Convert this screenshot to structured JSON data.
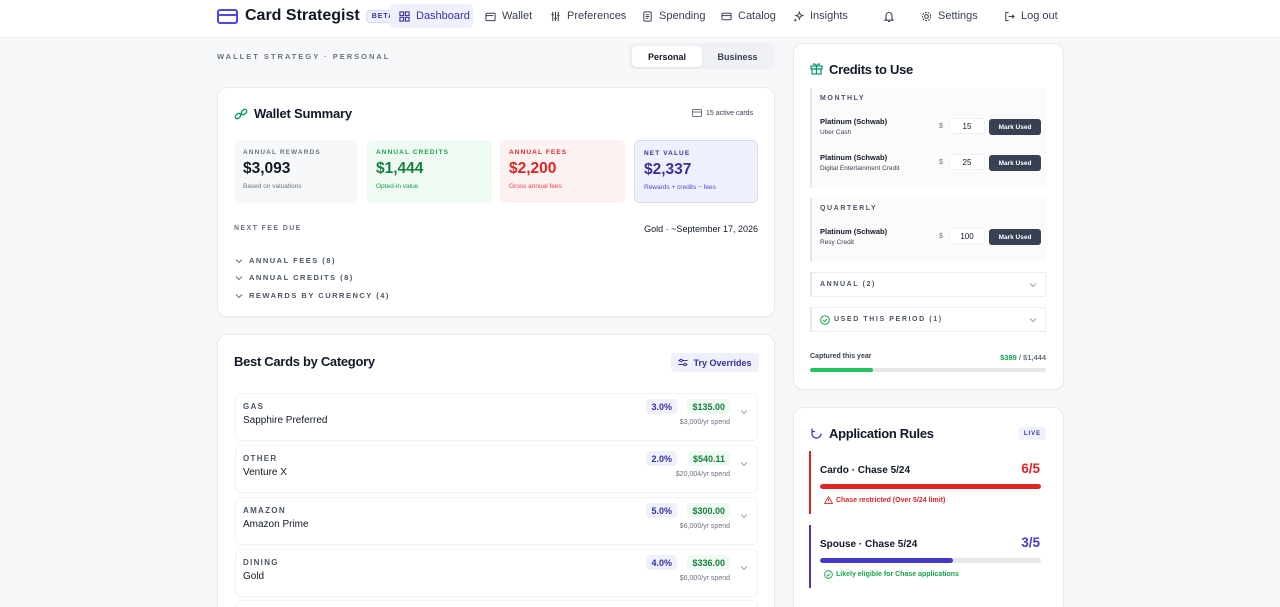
{
  "nav": {
    "brand": "Card Strategist",
    "badge": "BETA",
    "items": [
      {
        "label": "Dashboard",
        "active": true,
        "icon": "dashboard-icon"
      },
      {
        "label": "Wallet",
        "icon": "wallet-icon"
      },
      {
        "label": "Preferences",
        "icon": "sliders-icon"
      },
      {
        "label": "Spending",
        "icon": "receipt-icon"
      },
      {
        "label": "Catalog",
        "icon": "card-icon"
      },
      {
        "label": "Insights",
        "icon": "sparkles-icon"
      }
    ],
    "settings_label": "Settings",
    "logout_label": "Log out"
  },
  "page": {
    "breadcrumb": "WALLET STRATEGY · PERSONAL",
    "toggle": {
      "personal": "Personal",
      "business": "Business"
    }
  },
  "wallet_summary": {
    "title": "Wallet Summary",
    "active_cards": "15 active cards",
    "stats": {
      "rewards": {
        "label": "ANNUAL REWARDS",
        "value": "$3,093",
        "sub": "Based on valuations"
      },
      "credits": {
        "label": "ANNUAL CREDITS",
        "value": "$1,444",
        "sub": "Opted-in value"
      },
      "fees": {
        "label": "ANNUAL FEES",
        "value": "$2,200",
        "sub": "Gross annual fees"
      },
      "net": {
        "label": "NET VALUE",
        "value": "$2,337",
        "sub": "Rewards + credits − fees"
      }
    },
    "next_fee_label": "NEXT FEE DUE",
    "next_fee_value": "Gold · ~September 17, 2026",
    "sections": [
      "ANNUAL FEES (8)",
      "ANNUAL CREDITS (8)",
      "REWARDS BY CURRENCY (4)"
    ]
  },
  "best_cards": {
    "title": "Best Cards by Category",
    "overrides_label": "Try Overrides",
    "rows": [
      {
        "category": "GAS",
        "card": "Sapphire Preferred",
        "rate": "3.0%",
        "value": "$135.00",
        "spend": "$3,000/yr spend"
      },
      {
        "category": "OTHER",
        "card": "Venture X",
        "rate": "2.0%",
        "value": "$540.11",
        "spend": "$20,004/yr spend"
      },
      {
        "category": "AMAZON",
        "card": "Amazon Prime",
        "rate": "5.0%",
        "value": "$300.00",
        "spend": "$6,000/yr spend"
      },
      {
        "category": "DINING",
        "card": "Gold",
        "rate": "4.0%",
        "value": "$336.00",
        "spend": "$6,000/yr spend"
      }
    ]
  },
  "credits": {
    "title": "Credits to Use",
    "monthly_label": "MONTHLY",
    "quarterly_label": "QUARTERLY",
    "currency_symbol": "$",
    "mark_label": "Mark Used",
    "monthly": [
      {
        "card": "Platinum (Schwab)",
        "credit": "Uber Cash",
        "amount": "15"
      },
      {
        "card": "Platinum (Schwab)",
        "credit": "Digital Entertainment Credit",
        "amount": "25"
      }
    ],
    "quarterly": [
      {
        "card": "Platinum (Schwab)",
        "credit": "Resy Credit",
        "amount": "100"
      }
    ],
    "annual_label": "ANNUAL (2)",
    "used_label": "USED THIS PERIOD (1)",
    "captured_label": "Captured this year",
    "captured_value": "$389",
    "captured_total": "/ $1,444",
    "captured_fraction": 0.269
  },
  "rules": {
    "title": "Application Rules",
    "live_badge": "LIVE",
    "items": [
      {
        "name": "Cardo · Chase 5/24",
        "count": "6/5",
        "fraction": 1.0,
        "color": "#dc2626",
        "message": "Chase restricted (Over 5/24 limit)"
      },
      {
        "name": "Spouse · Chase 5/24",
        "count": "3/5",
        "fraction": 0.6,
        "color": "#4338ca",
        "message": "Likely eligible for Chase applications"
      }
    ]
  }
}
